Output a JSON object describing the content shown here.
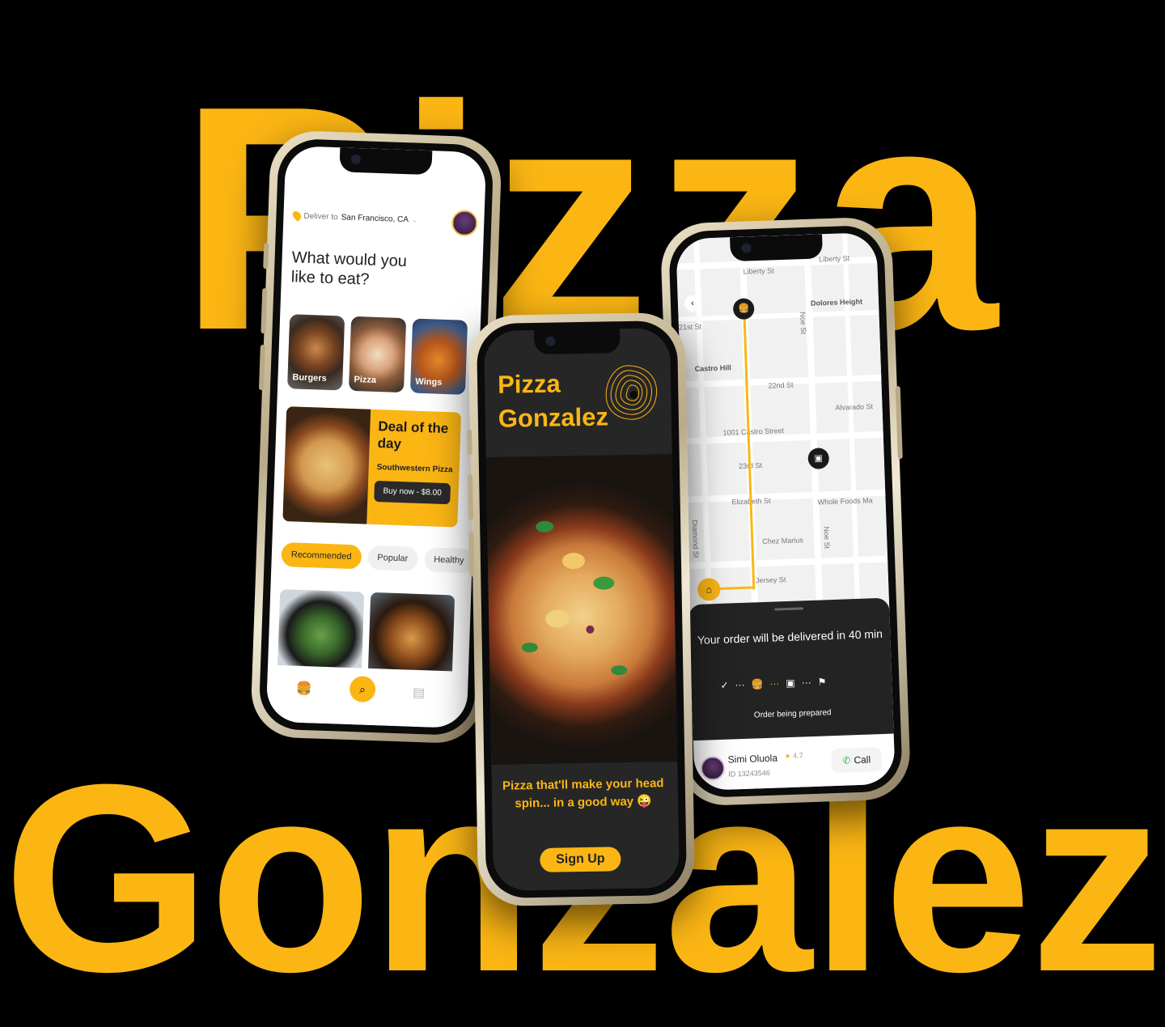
{
  "hero": {
    "word_top": "Pizza",
    "word_bottom": "Gonzalez",
    "accent_color": "#FBB614",
    "background": "#000000"
  },
  "home_screen": {
    "deliver_label": "Deliver to",
    "deliver_city": "San Francisco, CA",
    "headline": "What would you like to eat?",
    "categories": [
      "Burgers",
      "Pizza",
      "Wings"
    ],
    "deal": {
      "title": "Deal of the day",
      "item": "Southwestern Pizza",
      "button": "Buy now - $8.00"
    },
    "chips": [
      "Recommended",
      "Popular",
      "Healthy"
    ],
    "icons": [
      "location-pin-icon",
      "avatar",
      "burger-nav-icon",
      "search-icon",
      "receipt-icon"
    ]
  },
  "signup_screen": {
    "brand_line1": "Pizza",
    "brand_line2": "Gonzalez",
    "tagline": "Pizza that'll make your head spin... in a good way 😜",
    "signup_button": "Sign Up"
  },
  "tracking_screen": {
    "streets": [
      "Liberty St",
      "Liberty St",
      "Dolores Height",
      "Noe St",
      "21st St",
      "Castro Hill",
      "22nd St",
      "Alvarado St",
      "1001 Castro Street",
      "23rd St",
      "Elizabeth St",
      "Whole Foods Ma",
      "Diamond St",
      "Chez Marius",
      "Noe St",
      "Jersey St"
    ],
    "eta": "Your order will be delivered in 40 min",
    "status": "Order being prepared",
    "driver": {
      "name": "Simi Oluola",
      "rating": "4.7",
      "id": "ID 13243546",
      "call_label": "Call"
    }
  }
}
